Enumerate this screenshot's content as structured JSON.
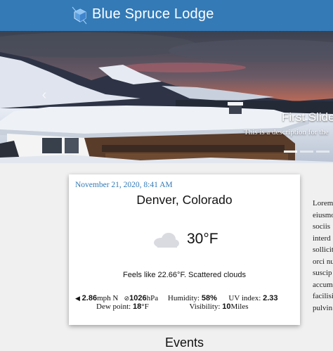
{
  "header": {
    "brand": "Blue Spruce Lodge",
    "logo_icon": "blue-crystal-icon",
    "background_color": "#337ab7"
  },
  "carousel": {
    "slide_title": "First Slide",
    "slide_description": "This is a description for the",
    "prev_icon": "chevron-left-icon",
    "indicator_count": 3,
    "active_indicator": 1
  },
  "weather": {
    "date": "November 21, 2020, 8:41 AM",
    "city": "Denver, Colorado",
    "condition_icon": "cloud-icon",
    "temperature": "30°F",
    "feels_like": "Feels like 22.66°F. Scattered clouds",
    "wind_value": "2.86",
    "wind_unit": "mph N",
    "pressure_value": "1026",
    "pressure_unit": "hPa",
    "humidity_label": "Humidity:",
    "humidity_value": "58%",
    "uv_label": "UV index:",
    "uv_value": "2.33",
    "dew_label": "Dew point:",
    "dew_value": "18",
    "dew_unit": "°F",
    "visibility_label": "Visibility:",
    "visibility_value": "10",
    "visibility_unit": "Miles"
  },
  "sidebar_text": [
    "Lorem",
    "eiusmo",
    "sociis",
    "interd",
    "sollicit",
    "orci nu",
    "suscip",
    "accum",
    "facilisi",
    "pulvin"
  ],
  "events": {
    "heading": "Events"
  }
}
